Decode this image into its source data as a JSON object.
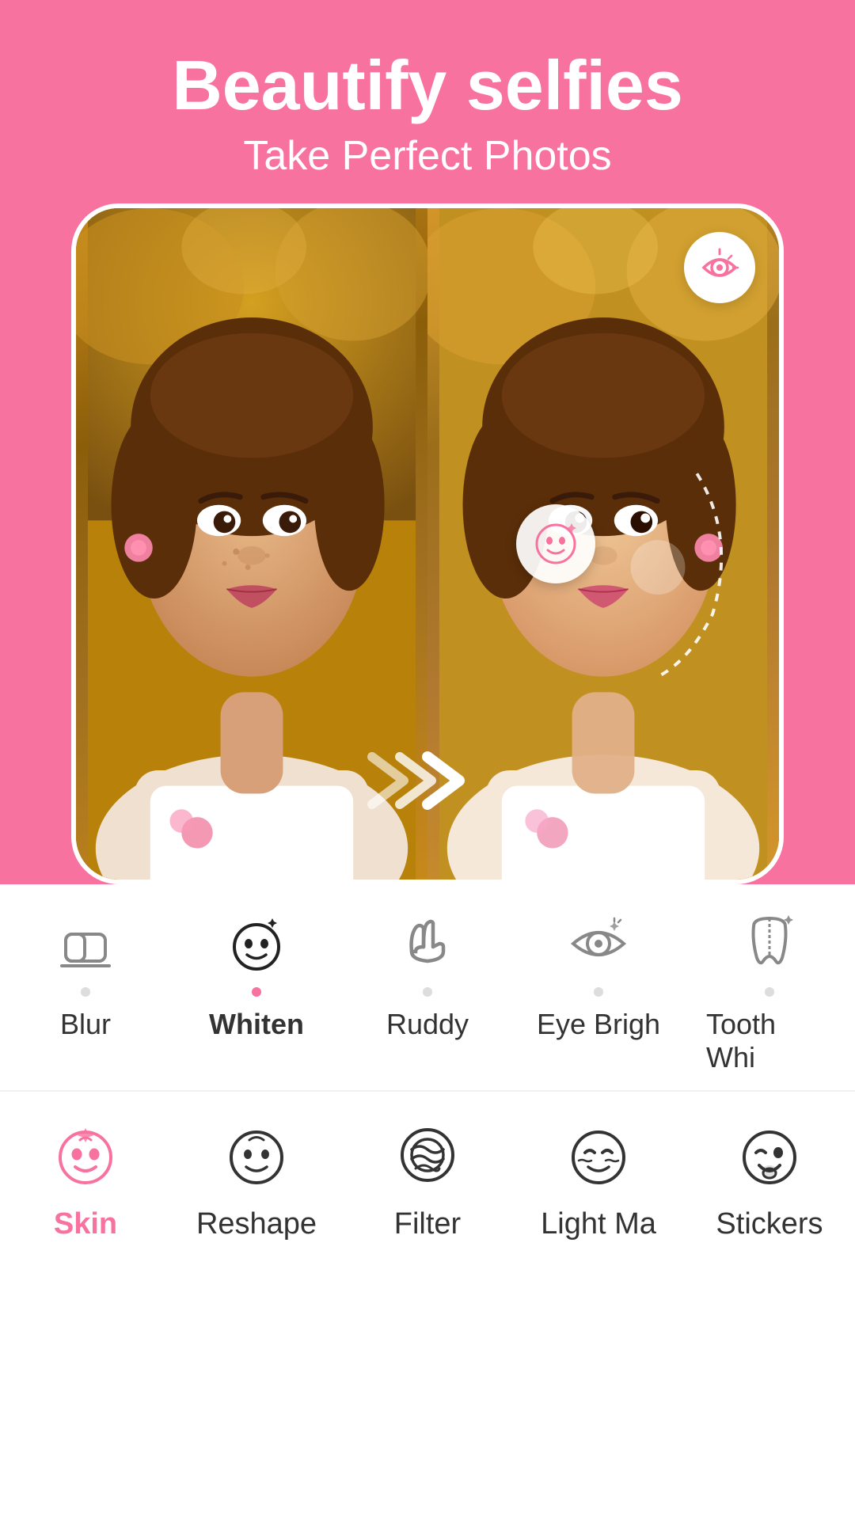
{
  "header": {
    "title": "Beautify selfies",
    "subtitle": "Take Perfect Photos"
  },
  "eye_button": {
    "label": "toggle-preview"
  },
  "feature_toolbar": {
    "items": [
      {
        "id": "blur",
        "label": "Blur",
        "active": false
      },
      {
        "id": "whiten",
        "label": "Whiten",
        "active": true
      },
      {
        "id": "ruddy",
        "label": "Ruddy",
        "active": false
      },
      {
        "id": "eye_brighten",
        "label": "Eye Brigh",
        "active": false
      },
      {
        "id": "tooth_whiten",
        "label": "Tooth Whi",
        "active": false
      }
    ]
  },
  "main_nav": {
    "items": [
      {
        "id": "skin",
        "label": "Skin",
        "active": true
      },
      {
        "id": "reshape",
        "label": "Reshape",
        "active": false
      },
      {
        "id": "filter",
        "label": "Filter",
        "active": false
      },
      {
        "id": "light_makeup",
        "label": "Light Ma",
        "active": false
      },
      {
        "id": "stickers",
        "label": "Stickers",
        "active": false
      }
    ]
  }
}
